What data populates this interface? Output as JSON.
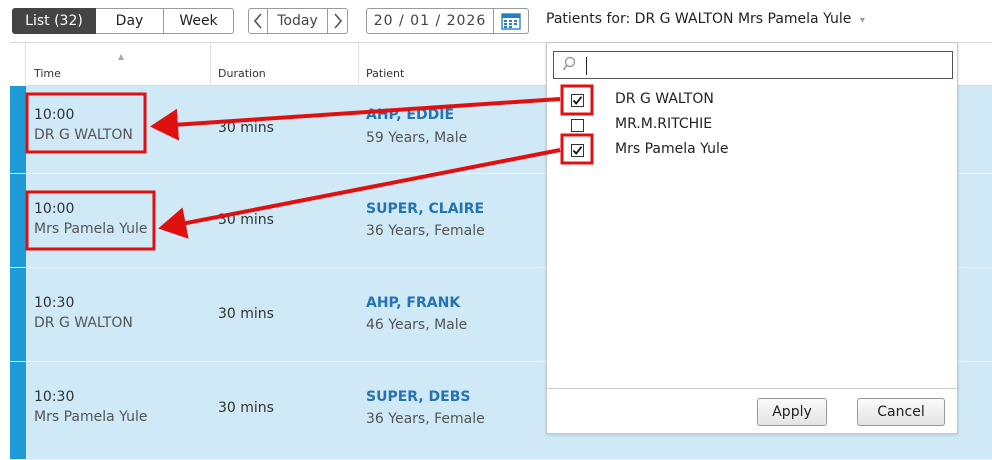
{
  "view_toggle": {
    "list_label": "List (32)",
    "day_label": "Day",
    "week_label": "Week"
  },
  "date_nav": {
    "prev_glyph": "〈",
    "today_label": "Today",
    "next_glyph": "〉"
  },
  "date_field": {
    "value": "20 / 01 / 2026",
    "icon": "calendar-icon"
  },
  "patients_for": {
    "label": "Patients for: DR G WALTON Mrs Pamela Yule",
    "caret": "▾"
  },
  "grid": {
    "headers": {
      "time": "Time",
      "duration": "Duration",
      "patient": "Patient"
    },
    "rows": [
      {
        "time": "10:00",
        "clinician": "DR G WALTON",
        "duration": "30 mins",
        "patient": "AHP, EDDIE",
        "info": "59 Years, Male"
      },
      {
        "time": "10:00",
        "clinician": "Mrs Pamela Yule",
        "duration": "30 mins",
        "patient": "SUPER, CLAIRE",
        "info": "36 Years, Female"
      },
      {
        "time": "10:30",
        "clinician": "DR G WALTON",
        "duration": "30 mins",
        "patient": "AHP, FRANK",
        "info": "46 Years, Male"
      },
      {
        "time": "10:30",
        "clinician": "Mrs Pamela Yule",
        "duration": "30 mins",
        "patient": "SUPER, DEBS",
        "info": "36 Years, Female"
      }
    ]
  },
  "clinician_picker": {
    "search_placeholder": "",
    "options": [
      {
        "label": "DR G WALTON",
        "checked": true
      },
      {
        "label": "MR.M.RITCHIE",
        "checked": false
      },
      {
        "label": "Mrs Pamela Yule",
        "checked": true
      }
    ],
    "apply_label": "Apply",
    "cancel_label": "Cancel"
  },
  "colors": {
    "row_bg": "#cfe9f7",
    "row_stripe": "#1e9ad6",
    "patient_link": "#2573b0",
    "annotation_red": "#e01010"
  }
}
